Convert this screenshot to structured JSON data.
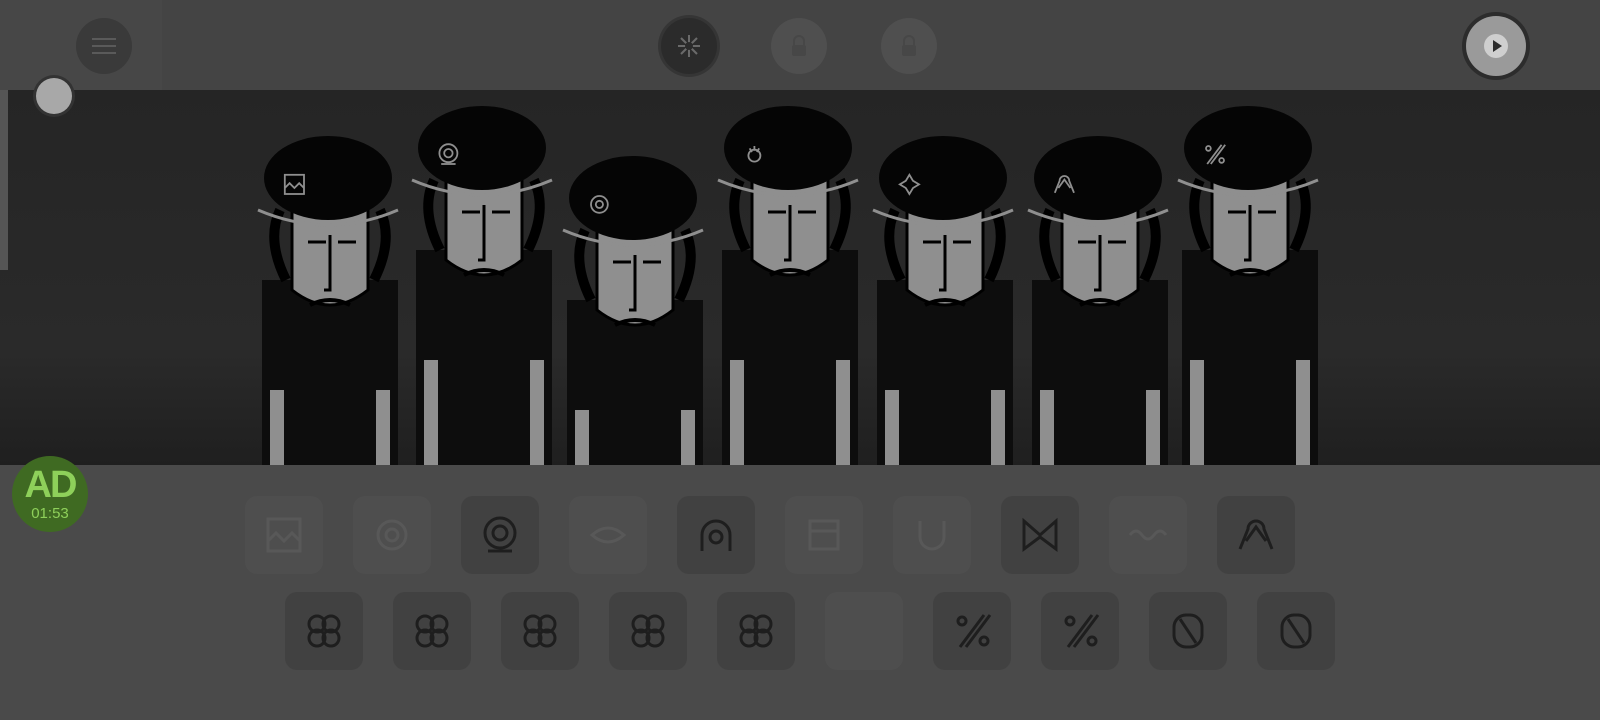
{
  "topbar": {
    "menu_icon": "hamburger-icon",
    "modes": [
      {
        "name": "sound-mode",
        "icon": "star-burst-icon",
        "active": true
      },
      {
        "name": "lock-mode-1",
        "icon": "lock-icon",
        "active": false
      },
      {
        "name": "lock-mode-2",
        "icon": "lock-icon",
        "active": false
      }
    ],
    "play_icon": "play-icon"
  },
  "stage": {
    "performers": [
      {
        "hat_icon": "waves-icon",
        "color": "#8f8f8f"
      },
      {
        "hat_icon": "target-icon",
        "color": "#8f8f8f"
      },
      {
        "hat_icon": "ring-icon",
        "color": "#8f8f8f"
      },
      {
        "hat_icon": "flower-icon",
        "color": "#8f8f8f"
      },
      {
        "hat_icon": "spark-icon",
        "color": "#8f8f8f"
      },
      {
        "hat_icon": "double-arc-icon",
        "color": "#8f8f8f"
      },
      {
        "hat_icon": "percent-icon",
        "color": "#8f8f8f"
      }
    ]
  },
  "ad_badge": {
    "label": "AD",
    "timer": "01:53"
  },
  "tray": {
    "row1": [
      {
        "icon": "waves-icon",
        "used": false
      },
      {
        "icon": "ring-icon",
        "used": false
      },
      {
        "icon": "target-icon",
        "used": true
      },
      {
        "icon": "lip-icon",
        "used": false
      },
      {
        "icon": "arch-ring-icon",
        "used": true
      },
      {
        "icon": "box-icon",
        "used": false
      },
      {
        "icon": "u-icon",
        "used": false
      },
      {
        "icon": "crown-m-icon",
        "used": true
      },
      {
        "icon": "wave-line-icon",
        "used": false
      },
      {
        "icon": "double-arc-icon",
        "used": true
      }
    ],
    "row2": [
      {
        "icon": "clover-icon",
        "used": true
      },
      {
        "icon": "clover-icon",
        "used": true
      },
      {
        "icon": "clover-icon",
        "used": true
      },
      {
        "icon": "clover-icon",
        "used": true
      },
      {
        "icon": "clover-icon",
        "used": true
      },
      {
        "icon": "empty-slot-icon",
        "used": false
      },
      {
        "icon": "percent-icon",
        "used": true
      },
      {
        "icon": "percent-icon",
        "used": true
      },
      {
        "icon": "zero-slash-icon",
        "used": true
      },
      {
        "icon": "zero-slash-icon",
        "used": true
      }
    ]
  },
  "colors": {
    "background": "#4a4a4a",
    "stage": "#252525",
    "ad_green": "#8ed05a"
  }
}
